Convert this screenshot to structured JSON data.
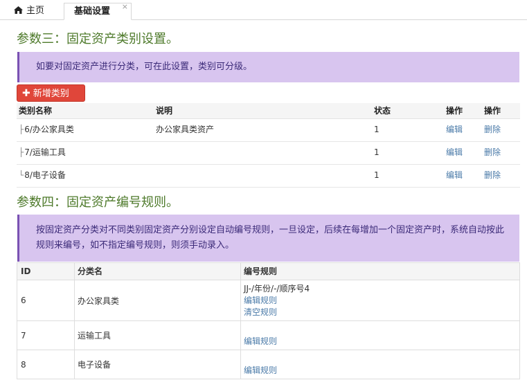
{
  "tabs": {
    "home_label": "主页",
    "active_label": "基础设置",
    "close_symbol": "×"
  },
  "section3": {
    "title": "参数三：固定资产类别设置。",
    "notice": "如要对固定资产进行分类，可在此设置，类别可分级。",
    "add_button": "新增类别",
    "headers": {
      "name": "类别名称",
      "desc": "说明",
      "state": "状态",
      "op1": "操作",
      "op2": "操作"
    },
    "rows": [
      {
        "tree": "├",
        "name": "6/办公家具类",
        "desc": "办公家具类资产",
        "state": "1",
        "edit": "编辑",
        "delete": "删除"
      },
      {
        "tree": "├",
        "name": "7/运输工具",
        "desc": "",
        "state": "1",
        "edit": "编辑",
        "delete": "删除"
      },
      {
        "tree": "└",
        "name": "8/电子设备",
        "desc": "",
        "state": "1",
        "edit": "编辑",
        "delete": "删除"
      }
    ]
  },
  "section4": {
    "title": "参数四：固定资产编号规则。",
    "notice": "按固定资产分类对不同类别固定资产分别设定自动编号规则，一旦设定，后续在每增加一个固定资产时，系统自动按此规则来编号，如不指定编号规则，则须手动录入。",
    "headers": {
      "id": "ID",
      "name": "分类名",
      "rule": "编号规则"
    },
    "rows": [
      {
        "id": "6",
        "name": "办公家具类",
        "rule": "JJ-/年份/-/顺序号4",
        "edit": "编辑规则",
        "clear": "清空规则"
      },
      {
        "id": "7",
        "name": "运输工具",
        "rule": "",
        "edit": "编辑规则",
        "clear": ""
      },
      {
        "id": "8",
        "name": "电子设备",
        "rule": "",
        "edit": "编辑规则",
        "clear": ""
      }
    ]
  },
  "colors": {
    "title_green": "#4e7a2b",
    "notice_bg": "#d8c5ef",
    "notice_border": "#7a52b3",
    "add_button_red": "#e0463a",
    "link_blue": "#4a7aa8"
  },
  "icons": {
    "home": "home-icon",
    "add": "plus-icon"
  }
}
